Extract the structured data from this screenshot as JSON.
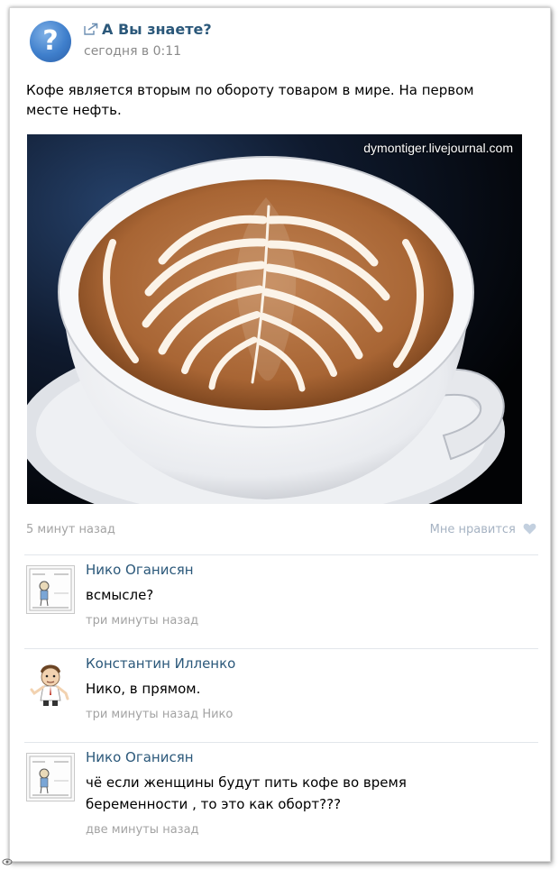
{
  "post": {
    "title": "А Вы знаете?",
    "time": "сегодня в 0:11",
    "text_line1": "Кофе является вторым по обороту товаром в мире. На первом",
    "text_line2": "месте нефть.",
    "avatar_glyph": "?",
    "avatar_icon": "question-mark-icon",
    "share_icon": "share-arrow-icon",
    "photo_watermark": "dymontiger.livejournal.com",
    "ago": "5 минут назад",
    "like_label": "Мне нравится",
    "like_icon": "heart-icon"
  },
  "comments": [
    {
      "author": "Нико Оганисян",
      "text_line1": "всмысле?",
      "text_line2": "",
      "time": "три минуты назад",
      "reply_to": "",
      "avatar_icon": "comic-drawing-avatar"
    },
    {
      "author": "Константин Илленко",
      "text_line1": "Нико, в прямом.",
      "text_line2": "",
      "time": "три минуты назад",
      "reply_to": "Нико",
      "avatar_icon": "cartoon-man-avatar"
    },
    {
      "author": "Нико Оганисян",
      "text_line1": "чё если женщины будут пить кофе во время",
      "text_line2": "беременности , то это как оборт???",
      "time": "две минуты назад",
      "reply_to": "",
      "avatar_icon": "comic-drawing-avatar"
    }
  ],
  "colors": {
    "link": "#2b587a",
    "muted": "#a3a3a3",
    "like": "#a6b3c3",
    "avatar_blue": "#3f7fcc"
  }
}
